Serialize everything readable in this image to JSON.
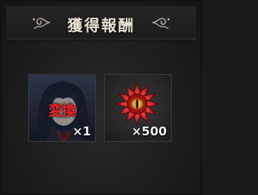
{
  "header": {
    "title": "獲得報酬"
  },
  "rewards": [
    {
      "icon": "character-portrait-icon",
      "badge": "変換",
      "quantity": "×1"
    },
    {
      "icon": "red-flower-eye-icon",
      "quantity": "×500"
    }
  ],
  "colors": {
    "title": "#e8e2d4",
    "badge": "#ff2020",
    "panel": "#1d1d1e",
    "gem": "#c81e1e"
  }
}
